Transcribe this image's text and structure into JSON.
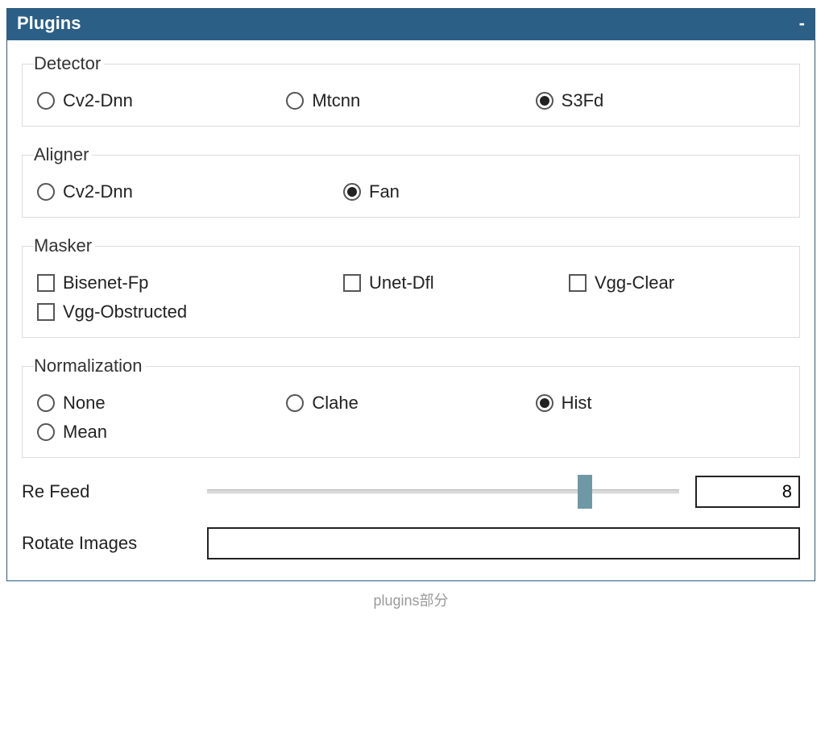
{
  "panel": {
    "title": "Plugins",
    "minimize_symbol": "-"
  },
  "groups": {
    "detector": {
      "legend": "Detector",
      "options": [
        {
          "id": "cv2dnn",
          "label": "Cv2-Dnn",
          "selected": false
        },
        {
          "id": "mtcnn",
          "label": "Mtcnn",
          "selected": false
        },
        {
          "id": "s3fd",
          "label": "S3Fd",
          "selected": true
        }
      ]
    },
    "aligner": {
      "legend": "Aligner",
      "options": [
        {
          "id": "cv2dnn",
          "label": "Cv2-Dnn",
          "selected": false
        },
        {
          "id": "fan",
          "label": "Fan",
          "selected": true
        }
      ]
    },
    "masker": {
      "legend": "Masker",
      "options": [
        {
          "id": "bisenetfp",
          "label": "Bisenet-Fp",
          "checked": false
        },
        {
          "id": "unetdfl",
          "label": "Unet-Dfl",
          "checked": false
        },
        {
          "id": "vggclear",
          "label": "Vgg-Clear",
          "checked": false
        },
        {
          "id": "vggobstructed",
          "label": "Vgg-Obstructed",
          "checked": false
        }
      ]
    },
    "normalization": {
      "legend": "Normalization",
      "options": [
        {
          "id": "none",
          "label": "None",
          "selected": false
        },
        {
          "id": "clahe",
          "label": "Clahe",
          "selected": false
        },
        {
          "id": "hist",
          "label": "Hist",
          "selected": true
        },
        {
          "id": "mean",
          "label": "Mean",
          "selected": false
        }
      ]
    }
  },
  "fields": {
    "refeed": {
      "label": "Re Feed",
      "value": "8",
      "slider_percent": 80
    },
    "rotate_images": {
      "label": "Rotate Images",
      "value": ""
    }
  },
  "caption": "plugins部分"
}
